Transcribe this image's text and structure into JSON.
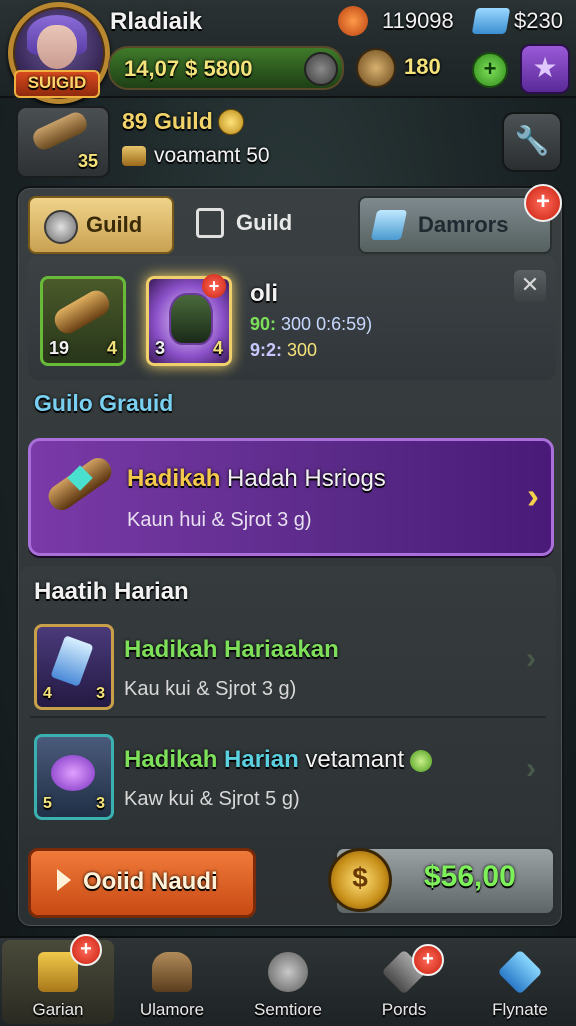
{
  "header": {
    "player_name": "Rladiaik",
    "avatar_badge": "SUIGID",
    "gold": "14,07 $ 5800",
    "resource1": "119098",
    "resource2": "$230",
    "resource3": "180",
    "add_symbol": "+",
    "star_symbol": "★"
  },
  "guild_info": {
    "item_count": "35",
    "title": "89 Guild",
    "subtitle": "voamamt 50"
  },
  "tabs": [
    {
      "label": "Guild",
      "active": true
    },
    {
      "label": "Guild",
      "active": false
    },
    {
      "label": "Damrors",
      "active": false
    }
  ],
  "tab_badge": "+",
  "reward": {
    "slot1_left": "19",
    "slot1_right": "4",
    "slot2_left": "3",
    "slot2_right": "4",
    "slot2_badge": "+",
    "title": "oli",
    "line1_a": "90:",
    "line1_b": "300 0:6:59)",
    "line2_a": "9:2:",
    "line2_b": "300",
    "close": "✕"
  },
  "section_title": "Guilo Grauid",
  "featured": {
    "title_highlight": "Hadikah",
    "title_rest": " Hadah Hsriogs",
    "desc": "Kaun hui & Sjrot 3 g)",
    "arrow": "›"
  },
  "daily": {
    "title": "Haatih Harian",
    "quests": [
      {
        "title": "Hadikah Hariaakan",
        "desc": "Kau kui & Sjrot 3 g)",
        "left": "4",
        "right": "3"
      },
      {
        "title_a": "Hadikah ",
        "title_b": "Harian",
        "title_c": " vetamant",
        "desc": "Kaw kui & Sjrot 5 g)",
        "left": "5",
        "right": "3"
      }
    ],
    "arrow": "›"
  },
  "buttons": {
    "claim": "Ooiid Naudi",
    "price_coin": "$",
    "price": "$56,00"
  },
  "nav": [
    {
      "label": "Garian"
    },
    {
      "label": "Ulamore"
    },
    {
      "label": "Semtiore"
    },
    {
      "label": "Pords"
    },
    {
      "label": "Flynate"
    }
  ],
  "nav_badges": [
    "+",
    "+"
  ],
  "colors": {
    "accent_gold": "#f4e27a",
    "accent_green": "#7ee05a",
    "accent_purple": "#7a3aa8",
    "badge_red": "#c8200e"
  }
}
